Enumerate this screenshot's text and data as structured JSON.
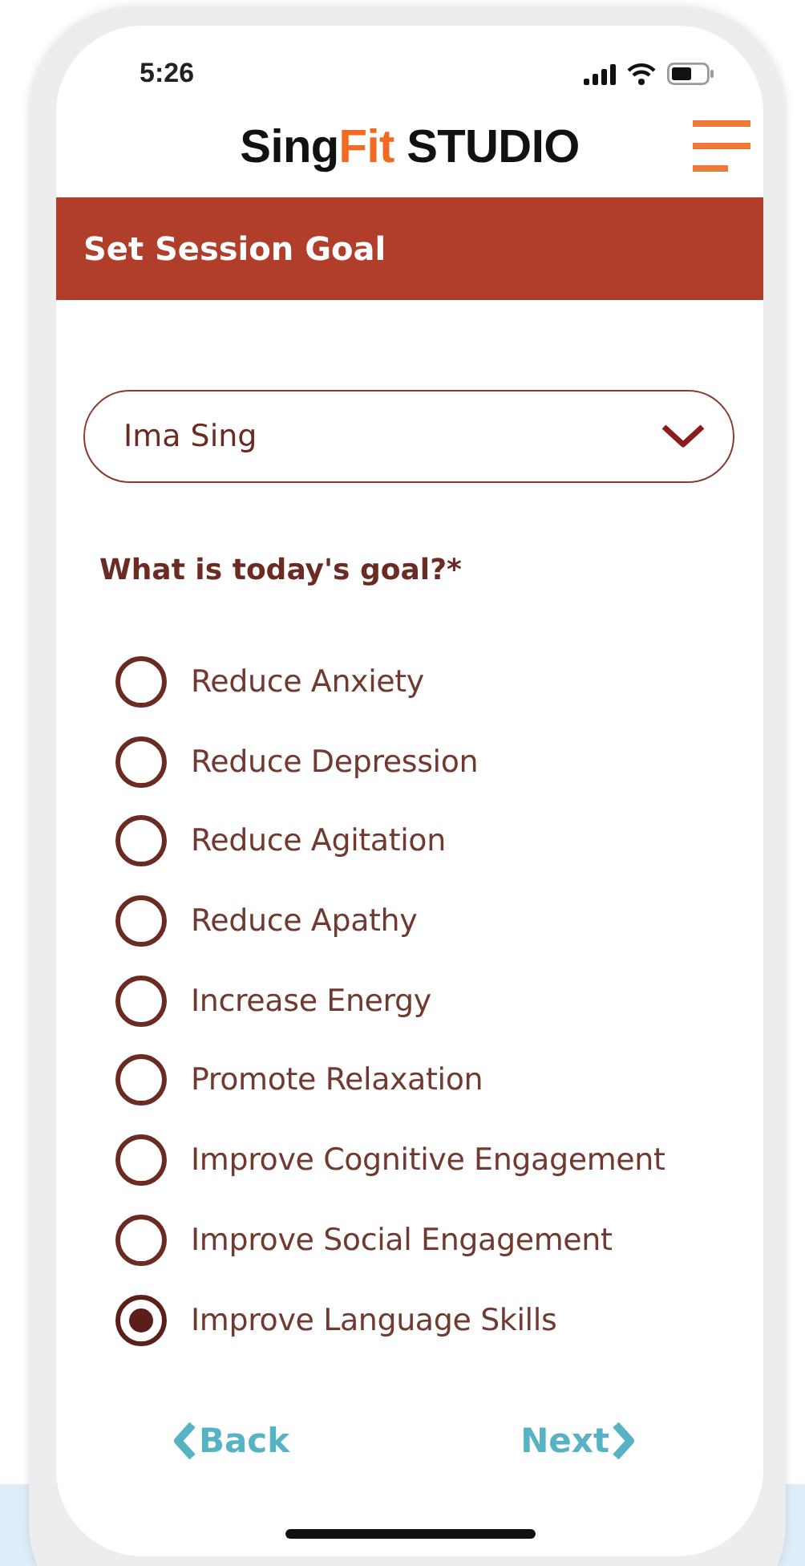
{
  "status_bar": {
    "time": "5:26"
  },
  "logo": {
    "parts": [
      {
        "text": "Sing",
        "highlight": false
      },
      {
        "text": "Fit",
        "highlight": true
      },
      {
        "text": " STUDIO",
        "highlight": false
      }
    ]
  },
  "header": {
    "title": "Set Session Goal"
  },
  "participant_select": {
    "value": "Ima Sing"
  },
  "question": "What is today's goal?*",
  "goals": [
    {
      "label": "Reduce Anxiety",
      "selected": false
    },
    {
      "label": "Reduce Depression",
      "selected": false
    },
    {
      "label": "Reduce Agitation",
      "selected": false
    },
    {
      "label": "Reduce Apathy",
      "selected": false
    },
    {
      "label": "Increase Energy",
      "selected": false
    },
    {
      "label": "Promote Relaxation",
      "selected": false
    },
    {
      "label": "Improve Cognitive Engagement",
      "selected": false
    },
    {
      "label": "Improve Social Engagement",
      "selected": false
    },
    {
      "label": "Improve Language Skills",
      "selected": true
    }
  ],
  "nav": {
    "back": "Back",
    "next": "Next"
  }
}
